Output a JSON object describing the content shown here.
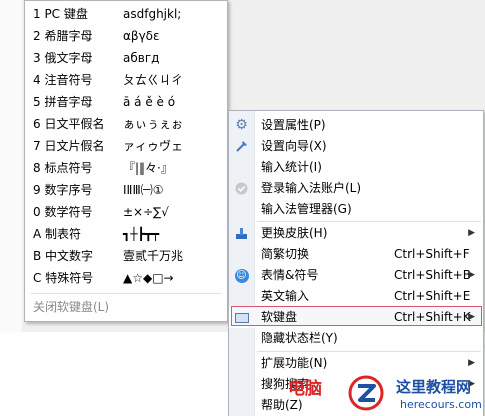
{
  "keyboard_menu": {
    "items": [
      {
        "label": "1 PC 键盘",
        "sample": "asdfghjkl;"
      },
      {
        "label": "2 希腊字母",
        "sample": "αβγδε"
      },
      {
        "label": "3 俄文字母",
        "sample": "абвгд"
      },
      {
        "label": "4 注音符号",
        "sample": "ㄆㄊㄍㄐㄔ"
      },
      {
        "label": "5 拼音字母",
        "sample": "ā á ě è ó"
      },
      {
        "label": "6 日文平假名",
        "sample": "ぁぃぅぇぉ"
      },
      {
        "label": "7 日文片假名",
        "sample": "ァィゥヴェ"
      },
      {
        "label": "8 标点符号",
        "sample": "『|‖々·』"
      },
      {
        "label": "9 数字序号",
        "sample": "ⅠⅡⅢ㈠①"
      },
      {
        "label": "0 数学符号",
        "sample": "±×÷∑√"
      },
      {
        "label": "A 制表符",
        "sample": "┓┼┣┳┯"
      },
      {
        "label": "B 中文数字",
        "sample": "壹贰千万兆"
      },
      {
        "label": "C 特殊符号",
        "sample": "▲☆◆□→"
      }
    ],
    "close_label": "关闭软键盘(L)"
  },
  "context_menu": {
    "items": [
      {
        "label": "设置属性(P)",
        "icon": "gear-icon"
      },
      {
        "label": "设置向导(X)",
        "icon": "wand-icon"
      },
      {
        "label": "输入统计(I)",
        "icon": ""
      },
      {
        "label": "登录输入法账户(L)",
        "icon": "user-icon"
      },
      {
        "label": "输入法管理器(G)",
        "icon": ""
      },
      {
        "label": "更换皮肤(H)",
        "icon": "skin-icon",
        "submenu": true
      },
      {
        "label": "简繁切换",
        "shortcut": "Ctrl+Shift+F"
      },
      {
        "label": "表情&符号",
        "icon": "smile-icon",
        "shortcut": "Ctrl+Shift+B",
        "submenu": true
      },
      {
        "label": "英文输入",
        "shortcut": "Ctrl+Shift+E"
      },
      {
        "label": "软键盘",
        "icon": "keyboard-icon",
        "shortcut": "Ctrl+Shift+K",
        "submenu": true,
        "highlighted": true
      },
      {
        "label": "隐藏状态栏(Y)"
      },
      {
        "label": "扩展功能(N)",
        "submenu": true
      },
      {
        "label": "搜狗搜索",
        "submenu": true
      },
      {
        "label": "帮助(Z)"
      }
    ]
  },
  "watermark": {
    "cn_text": "电脑",
    "site_title": "这里教程网",
    "site_url": "herecours.com"
  }
}
